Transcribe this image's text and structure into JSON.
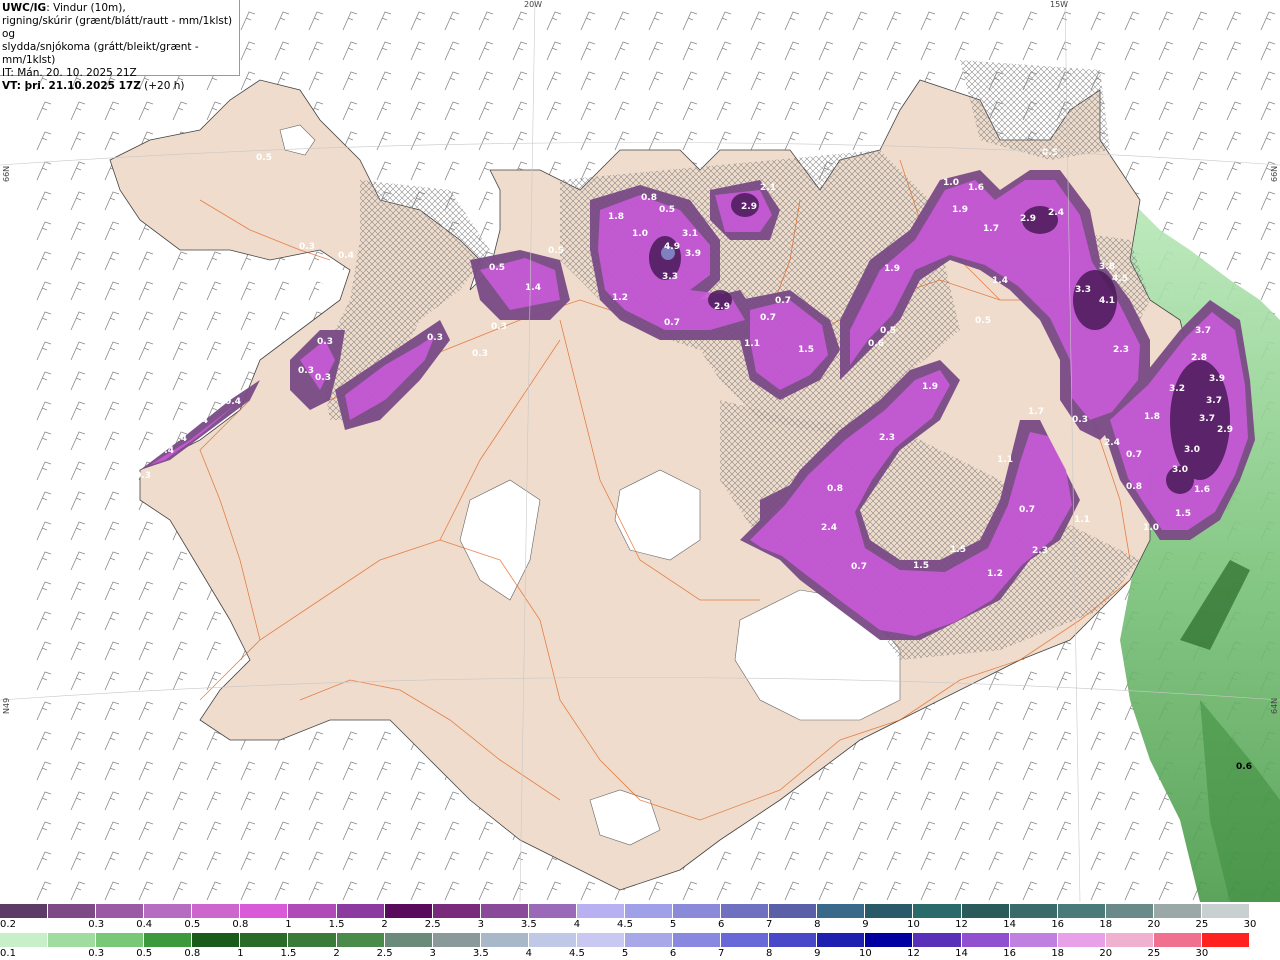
{
  "title": {
    "model": "UWC/IG",
    "line1": ": Vindur (10m),",
    "line2": "rigning/skúrir (grænt/blátt/rautt - mm/1klst) og",
    "line3": "slydda/snjókoma (grátt/bleikt/grænt - mm/1klst)",
    "line4": "IT: Mán. 20. 10. 2025 21Z",
    "line5_prefix": "VT: þri. 21.10.2025 17Z",
    "line5_suffix": " (+20 h)"
  },
  "graticule": {
    "lon_20w": "20W",
    "lon_15w": "15W",
    "lat_66n_left": "66N",
    "lat_66n_right": "66N",
    "lat_64n_left": "N49",
    "lat_64n_right": "64N"
  },
  "map_values": [
    "0.5",
    "0.3",
    "0.4",
    "0.3",
    "0.3",
    "0.3",
    "0.3",
    "0.4",
    "0.4",
    "0.4",
    "0.4",
    "0.3",
    "0.3",
    "1.8",
    "1.0",
    "0.8",
    "0.5",
    "4.9",
    "3.9",
    "3.3",
    "3.1",
    "2.9",
    "2.1",
    "1.2",
    "0.7",
    "2.9",
    "1.4",
    "0.5",
    "0.3",
    "0.3",
    "0.5",
    "0.7",
    "1.5",
    "0.7",
    "0.6",
    "0.5",
    "1.1",
    "1.9",
    "1.0",
    "1.6",
    "1.9",
    "1.7",
    "2.9",
    "2.4",
    "1.4",
    "0.5",
    "3.8",
    "3.3",
    "4.1",
    "4.5",
    "2.3",
    "1.9",
    "2.3",
    "1.7",
    "0.3",
    "1.1",
    "0.8",
    "2.4",
    "0.7",
    "1.5",
    "1.5",
    "1.2",
    "0.7",
    "2.3",
    "1.1",
    "2.4",
    "0.7",
    "0.8",
    "1.8",
    "1.0",
    "3.7",
    "2.8",
    "3.2",
    "3.9",
    "3.7",
    "3.7",
    "2.9",
    "3.0",
    "3.0",
    "1.6",
    "1.5",
    "0.6",
    "0.5"
  ],
  "legend": {
    "row1_labels": [
      "0.2",
      "0.3",
      "0.4",
      "0.5",
      "0.8",
      "1",
      "1.5",
      "2",
      "2.5",
      "3",
      "3.5",
      "4",
      "4.5",
      "5",
      "6",
      "7",
      "8",
      "9",
      "10",
      "12",
      "14",
      "16",
      "18",
      "20",
      "25",
      "30"
    ],
    "row1_colors": [
      "#5e3a66",
      "#7d4a86",
      "#9a5aa4",
      "#b66cc0",
      "#cc66cc",
      "#d85ad8",
      "#b04ab8",
      "#8c3aa0",
      "#5a0a5a",
      "#7a2a7a",
      "#8a4a9a",
      "#9a6ab8",
      "#b8b0f0",
      "#a0a0e8",
      "#8a8ad8",
      "#7070c0",
      "#5a60a8",
      "#3a6a8a",
      "#2a5a6a",
      "#2a6a6a",
      "#2a5a5a",
      "#3a6a6a",
      "#4a7a7a",
      "#6a8a8a",
      "#9aa8a8",
      "#c8d0d0"
    ],
    "row2_labels": [
      "0.1",
      "0.3",
      "0.5",
      "0.8",
      "1",
      "1.5",
      "2",
      "2.5",
      "3",
      "3.5",
      "4",
      "4.5",
      "5",
      "6",
      "7",
      "8",
      "9",
      "10",
      "12",
      "14",
      "16",
      "18",
      "20",
      "25",
      "30"
    ],
    "row2_colors": [
      "#c8f0c8",
      "#a0dca0",
      "#78c878",
      "#3c9a3c",
      "#1a5a1a",
      "#2a6a2a",
      "#3a7a3a",
      "#4a8a4a",
      "#6a8a7a",
      "#8a9a9a",
      "#a8b8c8",
      "#c0c8e8",
      "#c8c8f0",
      "#a8a8e8",
      "#8888e0",
      "#6868d8",
      "#4848c8",
      "#2020b0",
      "#0000a0",
      "#5a30b8",
      "#9050d0",
      "#c080e0",
      "#e8a0e8",
      "#f0b0d0",
      "#f07090",
      "#ff2020"
    ]
  },
  "colors": {
    "land": "#efdccc",
    "road": "#e0601a",
    "sea": "#ffffff",
    "precip_snow_main": "#c95ad8",
    "precip_snow_dark": "#6a2a78",
    "precip_rain_green": "#7ccc7c"
  }
}
